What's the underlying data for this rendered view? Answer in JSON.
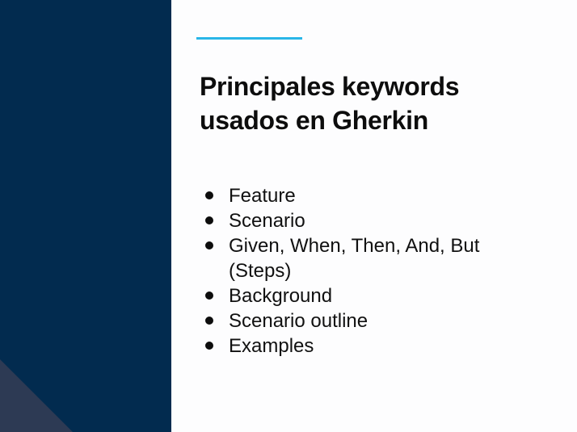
{
  "slide": {
    "title_lines": [
      "Principales keywords",
      "usados en Gherkin"
    ],
    "bullets": [
      "Feature",
      "Scenario",
      "Given, When, Then, And, But (Steps)",
      "Background",
      "Scenario outline",
      "Examples"
    ]
  },
  "colors": {
    "sidebar": "#022b4f",
    "sidebar_triangle": "#2d3a54",
    "accent_line": "#29b6e8"
  }
}
